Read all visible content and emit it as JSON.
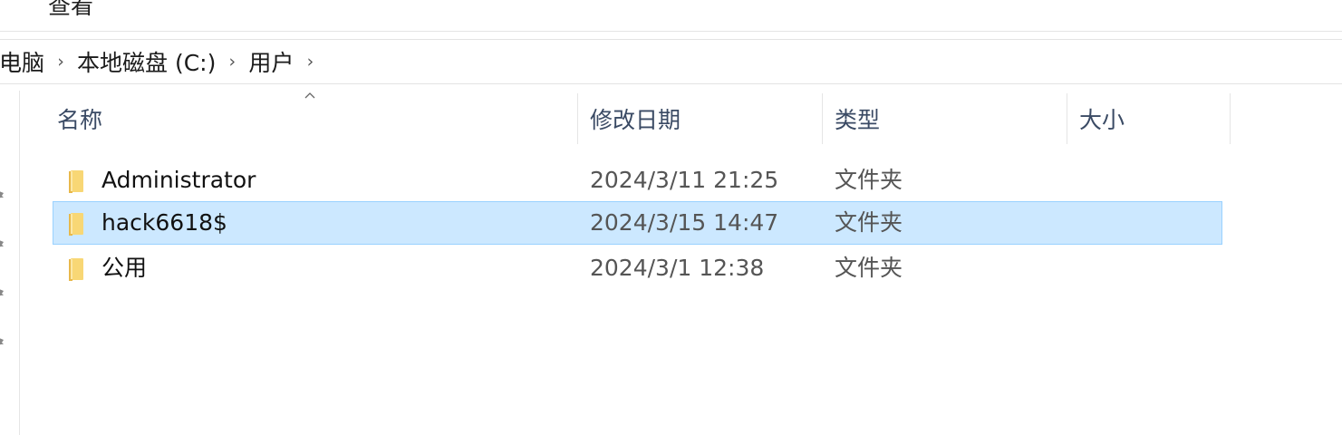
{
  "ribbon": {
    "view_tab": "查看"
  },
  "breadcrumb": {
    "items": [
      "电脑",
      "本地磁盘 (C:)",
      "用户"
    ],
    "separator": "›"
  },
  "columns": {
    "name": "名称",
    "modified": "修改日期",
    "type": "类型",
    "size": "大小"
  },
  "files": [
    {
      "name": "Administrator",
      "modified": "2024/3/11 21:25",
      "type": "文件夹",
      "size": "",
      "selected": false
    },
    {
      "name": "hack6618$",
      "modified": "2024/3/15 14:47",
      "type": "文件夹",
      "size": "",
      "selected": true
    },
    {
      "name": "公用",
      "modified": "2024/3/1 12:38",
      "type": "文件夹",
      "size": "",
      "selected": false
    }
  ],
  "icons": {
    "folder": "folder-icon",
    "pin": "pin-icon",
    "chevron": "chevron-right-icon",
    "sort": "sort-ascending-icon"
  },
  "colors": {
    "selection_bg": "#cce8ff",
    "selection_border": "#99d1ff",
    "folder_yellow": "#f8d775",
    "header_text": "#3a4a64"
  }
}
